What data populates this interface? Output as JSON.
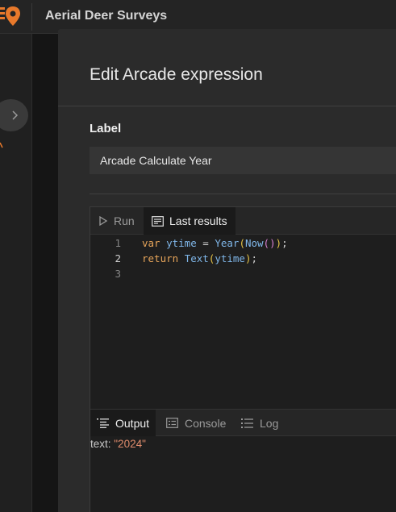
{
  "header": {
    "app_title": "Aerial Deer Surveys"
  },
  "modal": {
    "title": "Edit Arcade expression",
    "label_heading": "Label",
    "label_value": "Arcade Calculate Year"
  },
  "editor": {
    "run_label": "Run",
    "last_results_label": "Last results",
    "lines": [
      {
        "number": "1",
        "tokens": [
          {
            "cls": "kw",
            "text": "var "
          },
          {
            "cls": "var",
            "text": "ytime"
          },
          {
            "cls": "plain",
            "text": " = "
          },
          {
            "cls": "fn",
            "text": "Year"
          },
          {
            "cls": "p1",
            "text": "("
          },
          {
            "cls": "fn",
            "text": "Now"
          },
          {
            "cls": "p2",
            "text": "()"
          },
          {
            "cls": "p1",
            "text": ")"
          },
          {
            "cls": "plain",
            "text": ";"
          }
        ]
      },
      {
        "number": "2",
        "tokens": [
          {
            "cls": "kw",
            "text": "return "
          },
          {
            "cls": "fn",
            "text": "Text"
          },
          {
            "cls": "p1",
            "text": "("
          },
          {
            "cls": "var",
            "text": "ytime"
          },
          {
            "cls": "p1",
            "text": ")"
          },
          {
            "cls": "plain",
            "text": ";"
          }
        ]
      },
      {
        "number": "3",
        "tokens": []
      }
    ]
  },
  "results": {
    "tabs": {
      "output": "Output",
      "console": "Console",
      "log": "Log"
    },
    "output_key": "text: ",
    "output_value": "\"2024\""
  },
  "colors": {
    "accent_brand": "#e8792b",
    "keyword": "#e7a55a",
    "identifier": "#7fb6e8",
    "string_value": "#e08c6c"
  },
  "icons": {
    "logo": "location-pin-logo-icon",
    "expand": "chevron-right-icon",
    "run": "play-icon",
    "last_results": "results-table-icon",
    "output": "list-icon",
    "console": "console-icon",
    "log": "log-list-icon"
  }
}
